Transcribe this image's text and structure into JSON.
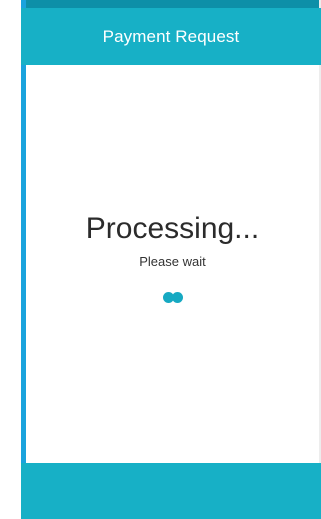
{
  "header": {
    "title": "Payment Request"
  },
  "main": {
    "status_title": "Processing...",
    "status_subtitle": "Please wait"
  },
  "colors": {
    "accent": "#17b0c6",
    "status_bar": "#0d8fa8",
    "left_edge": "#1aa3dd"
  }
}
